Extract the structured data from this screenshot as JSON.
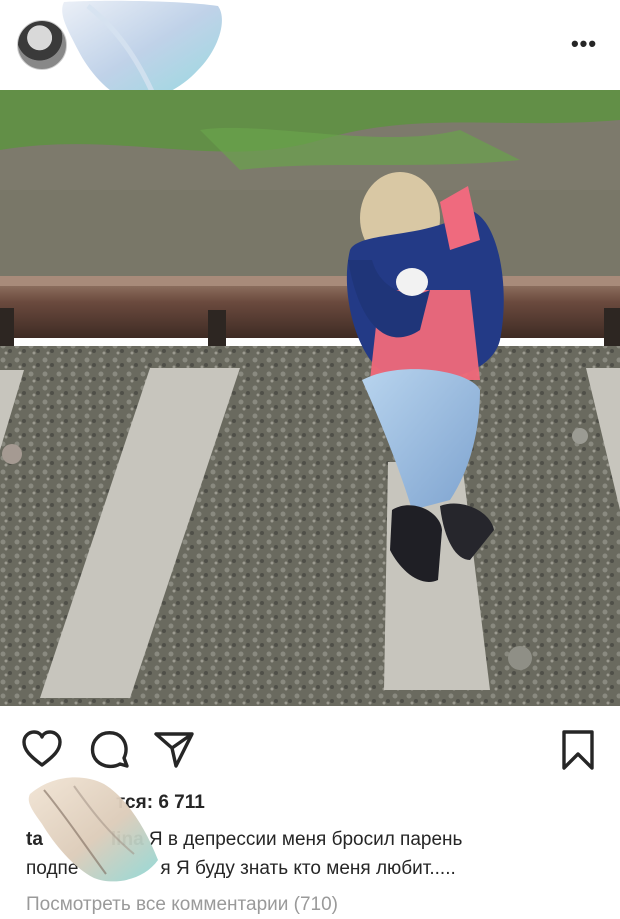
{
  "post": {
    "likes_label": "тся: 6 711",
    "caption_user_fragment_1": "ta",
    "caption_user_fragment_2": "lina",
    "caption_line1_text": "Я в депрессии меня бросил парень",
    "caption_line2_start": "подпе",
    "caption_line2_rest": "я Я буду знать кто меня любит.....",
    "view_comments_label": "Посмотреть все комментарии (710)"
  },
  "icons": {
    "more": "more-options-icon",
    "like": "heart-icon",
    "comment": "comment-icon",
    "share": "send-icon",
    "save": "bookmark-icon"
  },
  "colors": {
    "text": "#262626",
    "secondary_text": "#9a9a9a",
    "background": "#ffffff"
  }
}
